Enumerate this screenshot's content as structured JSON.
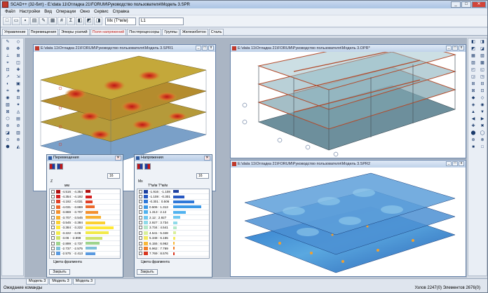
{
  "app": {
    "title": "SCAD++ (32-бит) - E:\\data 11\\Отладка 21\\FORUM\\Руководство пользователя\\Модель 3.SPR",
    "win_buttons": [
      "_",
      "□",
      "✕"
    ]
  },
  "menu": [
    "Файл",
    "Настройки",
    "Вид",
    "Операции",
    "Окно",
    "Сервис",
    "Справка"
  ],
  "toolbar": {
    "mode_value": "Mx (Т*м/м)",
    "load_value": "L1"
  },
  "ribbon_tabs": [
    {
      "label": "Управление"
    },
    {
      "label": "Перемещения"
    },
    {
      "label": "Эпюры усилий"
    },
    {
      "label": "Поля напряжений",
      "active": true
    },
    {
      "label": "Постпроцессоры"
    },
    {
      "label": "Группы"
    },
    {
      "label": "Железобетон"
    },
    {
      "label": "Сталь"
    }
  ],
  "windows": {
    "spr1": {
      "title": "E:\\data 11\\Отладка 21\\FORUM\\Руководство пользователя\\Модель 3.SPR1"
    },
    "opr": {
      "title": "E:\\data 11\\Отладка 21\\FORUM\\Руководство пользователя\\Модель 3.OPR*"
    },
    "spr2": {
      "title": "E:\\data 11\\Отладка 21\\FORUM\\Руководство пользователя\\Модель 3.SPR2"
    }
  },
  "panel_disp": {
    "title": "Перемещения",
    "dd": "16",
    "unit_label": "Z",
    "unit": "мм",
    "color_footer": "Цвета фрагмента",
    "close": "Закрыть",
    "rows": [
      {
        "label": "-4.516 : -4.354",
        "color": "#b01010",
        "bar": 0.18
      },
      {
        "label": "-4.354 : -4.192",
        "color": "#d41f1f",
        "bar": 0.22
      },
      {
        "label": "-4.192 : -4.031",
        "color": "#e0412a",
        "bar": 0.25
      },
      {
        "label": "-4.031 : -3.869",
        "color": "#ec6a2c",
        "bar": 0.32
      },
      {
        "label": "-3.869 : -3.707",
        "color": "#f3902e",
        "bar": 0.45
      },
      {
        "label": "-3.707 : -3.545",
        "color": "#f8b030",
        "bar": 0.55
      },
      {
        "label": "-3.545 : -3.384",
        "color": "#fbd033",
        "bar": 0.7
      },
      {
        "label": "-3.384 : -3.222",
        "color": "#ffe838",
        "bar": 1.0
      },
      {
        "label": "-3.222 : -3.06",
        "color": "#f2ea4a",
        "bar": 0.82
      },
      {
        "label": "-3.06 : -2.899",
        "color": "#cfe36a",
        "bar": 0.6
      },
      {
        "label": "-2.899 : -2.737",
        "color": "#9fd48e",
        "bar": 0.5
      },
      {
        "label": "-2.737 : -2.575",
        "color": "#7fc0d8",
        "bar": 0.4
      },
      {
        "label": "-2.575 : -2.413",
        "color": "#5a9ae0",
        "bar": 0.35
      }
    ]
  },
  "panel_stress": {
    "title": "Напряжения",
    "dd": "16",
    "unit_label": "Mx",
    "unit": "Т*м/м  Т*м/м",
    "color_footer": "Цвета фрагмента",
    "close": "Закрыть",
    "rows": [
      {
        "label": "-1.916 : -1.108",
        "color": "#1b3fa0",
        "bar": 0.2
      },
      {
        "label": "-1.108 : -0.301",
        "color": "#2658c2",
        "bar": 0.4
      },
      {
        "label": "-0.301 : 0.506",
        "color": "#2f78d8",
        "bar": 0.75
      },
      {
        "label": "0.506 : 1.313",
        "color": "#3a98e6",
        "bar": 1.0
      },
      {
        "label": "1.313 : 2.12",
        "color": "#50b2ef",
        "bar": 0.45
      },
      {
        "label": "2.12 : 2.927",
        "color": "#6ec8f0",
        "bar": 0.25
      },
      {
        "label": "2.927 : 3.734",
        "color": "#8fdae9",
        "bar": 0.15
      },
      {
        "label": "3.734 : 4.541",
        "color": "#b4e8c8",
        "bar": 0.12
      },
      {
        "label": "4.541 : 5.348",
        "color": "#d8ef9a",
        "bar": 0.1
      },
      {
        "label": "5.348 : 6.155",
        "color": "#f4ea5e",
        "bar": 0.08
      },
      {
        "label": "6.155 : 6.962",
        "color": "#f8b83a",
        "bar": 0.06
      },
      {
        "label": "6.962 : 7.769",
        "color": "#f07e2a",
        "bar": 0.05
      },
      {
        "label": "7.769 : 8.576",
        "color": "#d8361f",
        "bar": 0.04
      }
    ]
  },
  "window_tabs": [
    "Модель 3",
    "Модель 3",
    "Модель 3"
  ],
  "status": {
    "left": "Ожидание команды",
    "right": "Узлов 2247(0)  Элементов 2676(0)"
  }
}
